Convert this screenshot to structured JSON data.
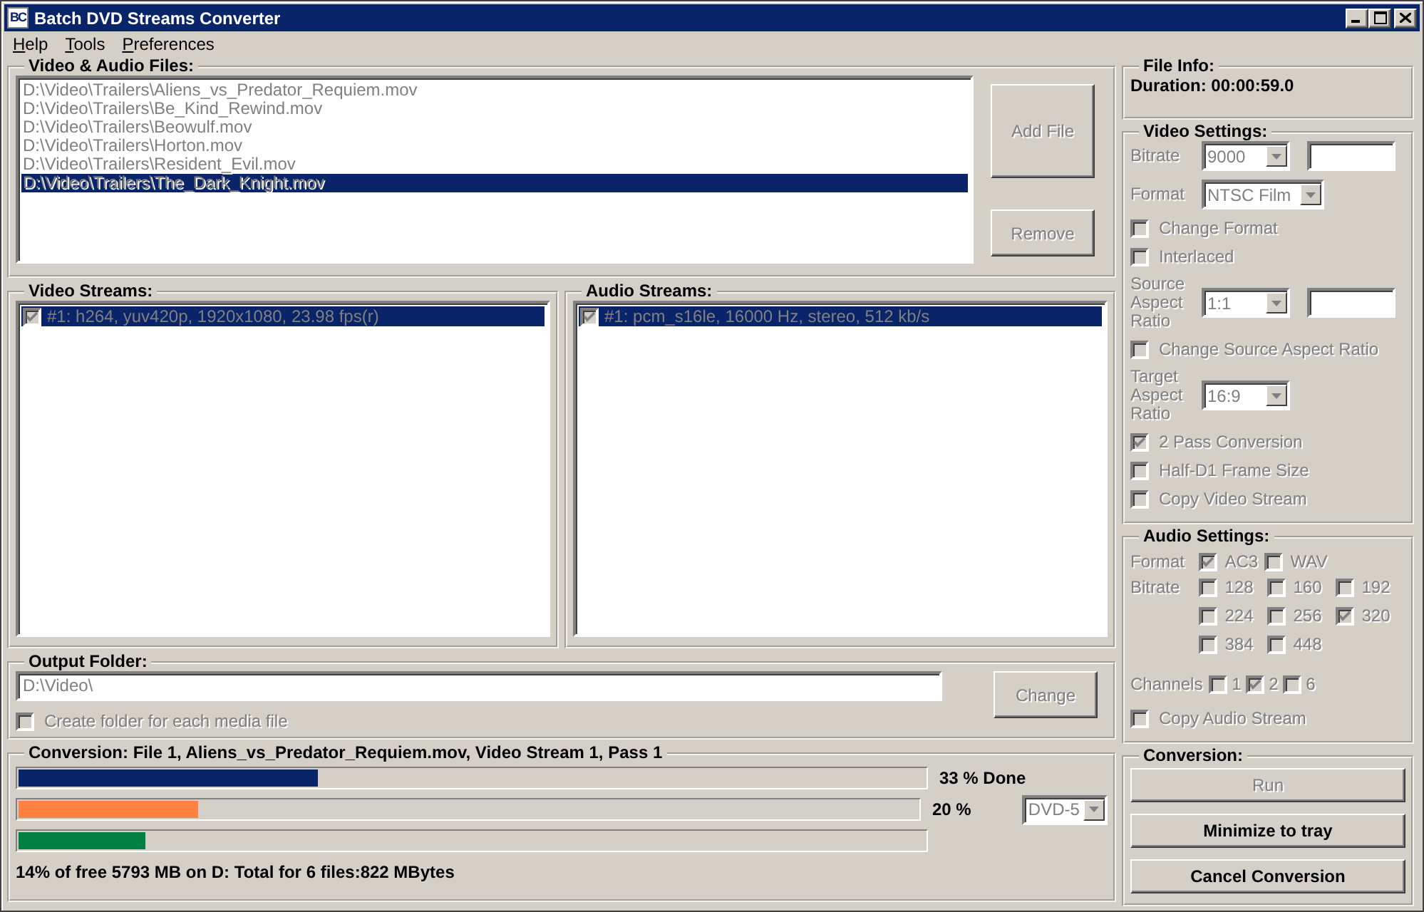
{
  "window": {
    "title": "Batch DVD Streams Converter",
    "icon_text": "BC"
  },
  "menu": [
    {
      "label": "Help"
    },
    {
      "label": "Tools"
    },
    {
      "label": "Preferences"
    }
  ],
  "files": {
    "title": "Video & Audio Files:",
    "disabled": true,
    "items": [
      {
        "path": "D:\\Video\\Trailers\\Aliens_vs_Predator_Requiem.mov",
        "selected": false
      },
      {
        "path": "D:\\Video\\Trailers\\Be_Kind_Rewind.mov",
        "selected": false
      },
      {
        "path": "D:\\Video\\Trailers\\Beowulf.mov",
        "selected": false
      },
      {
        "path": "D:\\Video\\Trailers\\Horton.mov",
        "selected": false
      },
      {
        "path": "D:\\Video\\Trailers\\Resident_Evil.mov",
        "selected": false
      },
      {
        "path": "D:\\Video\\Trailers\\The_Dark_Knight.mov",
        "selected": true
      }
    ],
    "buttons": [
      {
        "label": "Add File",
        "disabled": true
      },
      {
        "label": "Remove",
        "disabled": true
      }
    ]
  },
  "video_streams": {
    "title": "Video Streams:",
    "items": [
      {
        "label": "#1: h264, yuv420p, 1920x1080, 23.98 fps(r)",
        "checked": true,
        "selected": true
      }
    ]
  },
  "audio_streams": {
    "title": "Audio Streams:",
    "items": [
      {
        "label": "#1: pcm_s16le, 16000 Hz, stereo, 512 kb/s",
        "checked": true,
        "selected": true
      }
    ]
  },
  "output_folder": {
    "title": "Output Folder:",
    "value": "D:\\Video\\",
    "create_folder": {
      "label": "Create folder for each media file",
      "checked": false
    },
    "button": {
      "label": "Change",
      "disabled": true
    }
  },
  "progress": {
    "title": "Conversion: File 1, Aliens_vs_Predator_Requiem.mov, Video Stream 1, Pass 1",
    "bars": [
      {
        "level": 0.33,
        "color": "#0a246a",
        "reading": "33 % Done"
      },
      {
        "level": 0.2,
        "color": "#ff8040",
        "reading": "20 %"
      },
      {
        "level": 0.14,
        "color": "#008040"
      }
    ],
    "disc": {
      "value": "DVD-5",
      "disabled": true
    },
    "status": "14% of free 5793 MB on D: Total for 6 files:822 MBytes"
  },
  "file_info": {
    "title": "File Info:",
    "duration": "Duration: 00:00:59.0"
  },
  "video_settings": {
    "title": "Video Settings:",
    "disabled": true,
    "rows": [
      {
        "kind": "combo",
        "label": "Bitrate",
        "value": "9000",
        "extra_field": true
      },
      {
        "kind": "combo",
        "label": "Format",
        "value": "NTSC Film",
        "extra_field": false
      },
      {
        "kind": "check",
        "label": "Change Format",
        "checked": false
      },
      {
        "kind": "check",
        "label": "Interlaced",
        "checked": false
      },
      {
        "kind": "combo",
        "label": "Source Aspect Ratio",
        "value": "1:1",
        "extra_field": true
      },
      {
        "kind": "check",
        "label": "Change Source Aspect Ratio",
        "checked": false
      },
      {
        "kind": "combo",
        "label": "Target Aspect Ratio",
        "value": "16:9",
        "extra_field": false
      },
      {
        "kind": "check",
        "label": "2 Pass Conversion",
        "checked": true
      },
      {
        "kind": "check",
        "label": "Half-D1 Frame Size",
        "checked": false
      },
      {
        "kind": "check",
        "label": "Copy Video Stream",
        "checked": false
      }
    ]
  },
  "audio_settings": {
    "title": "Audio Settings:",
    "disabled": true,
    "format": {
      "label": "Format",
      "options": [
        {
          "label": "AC3",
          "checked": true
        },
        {
          "label": "WAV",
          "checked": false
        }
      ]
    },
    "bitrate": {
      "label": "Bitrate",
      "options": [
        {
          "label": "128",
          "checked": false
        },
        {
          "label": "160",
          "checked": false
        },
        {
          "label": "192",
          "checked": false
        },
        {
          "label": "224",
          "checked": false
        },
        {
          "label": "256",
          "checked": false
        },
        {
          "label": "320",
          "checked": true
        },
        {
          "label": "384",
          "checked": false
        },
        {
          "label": "448",
          "checked": false
        }
      ]
    },
    "channels": {
      "label": "Channels",
      "options": [
        {
          "label": "1",
          "checked": false
        },
        {
          "label": "2",
          "checked": true
        },
        {
          "label": "6",
          "checked": false
        }
      ]
    },
    "copy": {
      "label": "Copy Audio Stream",
      "checked": false
    }
  },
  "conversion": {
    "title": "Conversion:",
    "buttons": [
      {
        "label": "Run",
        "disabled": true
      },
      {
        "label": "Minimize to tray",
        "disabled": false
      },
      {
        "label": "Cancel Conversion",
        "disabled": false
      }
    ]
  }
}
